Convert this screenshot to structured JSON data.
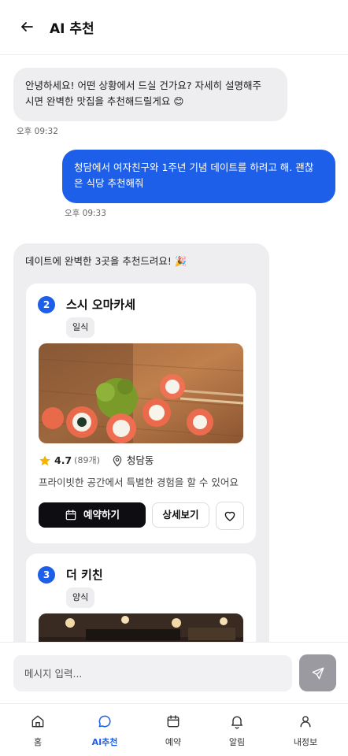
{
  "header": {
    "title": "AI 추천"
  },
  "chat": {
    "ai_greeting": {
      "line1": "안녕하세요! 어떤 상황에서 드실 건가요? 자세히 설명해주",
      "line2": "시면 완벽한 맛집을 추천해드릴게요 😊",
      "time": "오후 09:32"
    },
    "user_message": {
      "line1": "청담에서 여자친구와 1주년 기념 데이트를 하려고 해. 괜찮",
      "line2": "은 식당 추천해줘",
      "time": "오후 09:33"
    },
    "ai_recommend": {
      "intro": "데이트에 완벽한 3곳을 추천드려요! 🎉",
      "cards": [
        {
          "rank": "2",
          "name": "스시 오마카세",
          "category": "일식",
          "rating": "4.7",
          "reviews": "(89개)",
          "location": "청담동",
          "description": "프라이빗한 공간에서 특별한 경험을 할 수 있어요",
          "book_label": "예약하기",
          "detail_label": "상세보기"
        },
        {
          "rank": "3",
          "name": "더 키친",
          "category": "양식"
        }
      ]
    }
  },
  "input": {
    "placeholder": "메시지 입력..."
  },
  "nav": {
    "items": [
      {
        "label": "홈",
        "icon": "home-icon"
      },
      {
        "label": "AI추천",
        "icon": "chat-icon",
        "active": true
      },
      {
        "label": "예약",
        "icon": "calendar-icon"
      },
      {
        "label": "알림",
        "icon": "bell-icon"
      },
      {
        "label": "내정보",
        "icon": "user-icon"
      }
    ]
  },
  "colors": {
    "accent": "#1d5fe8",
    "dark_button": "#0d0d12",
    "bubble_gray": "#eeeef1",
    "star": "#f5b400"
  }
}
